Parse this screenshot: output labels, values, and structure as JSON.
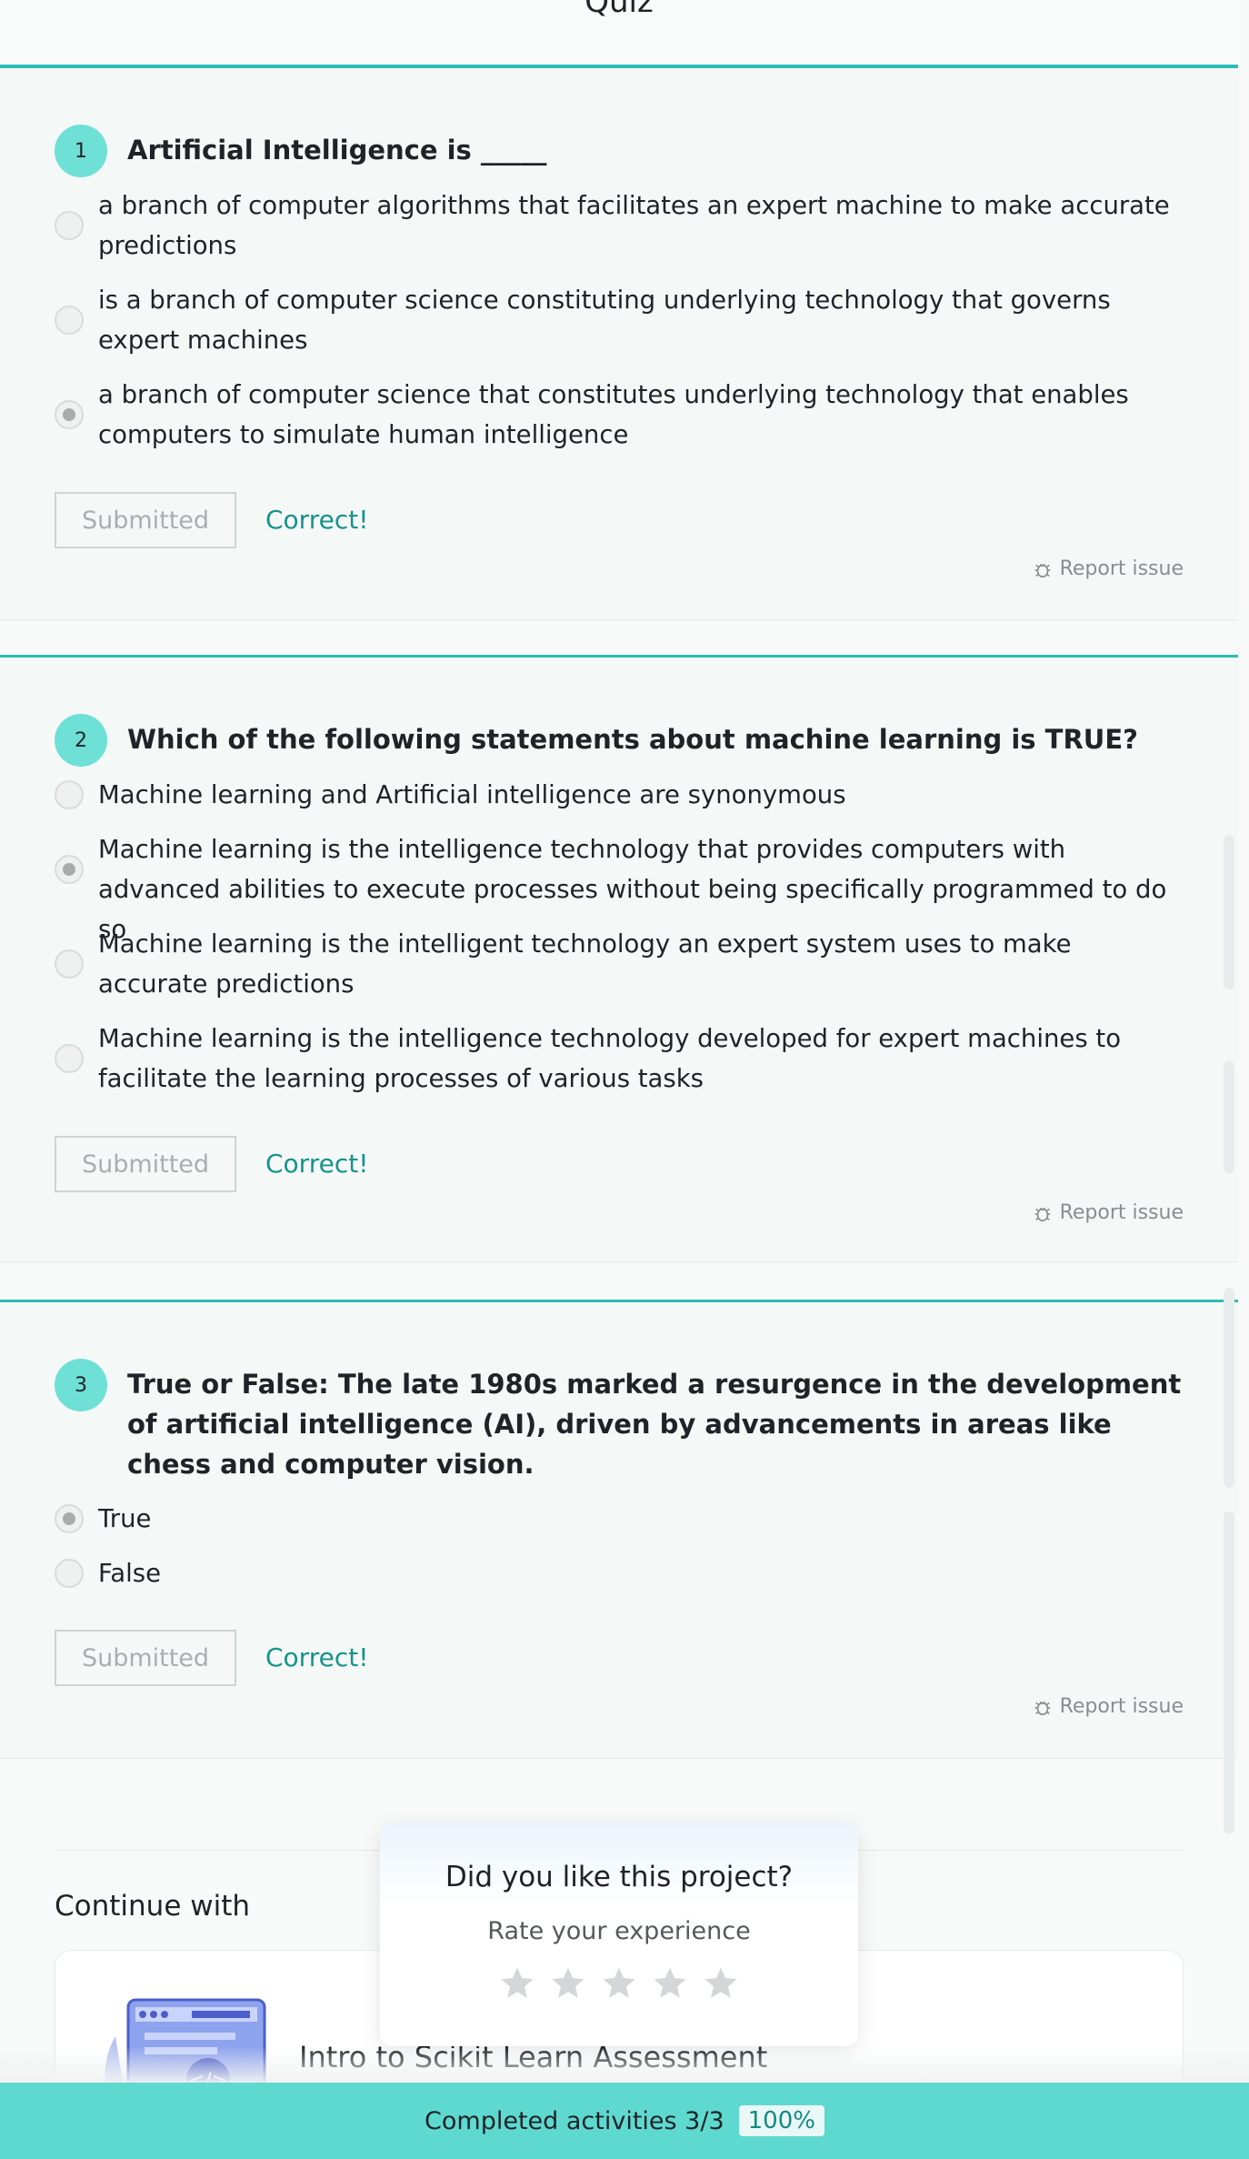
{
  "page": {
    "title": "Quiz"
  },
  "questions": [
    {
      "number": "1",
      "text": "Artificial Intelligence is _____",
      "options": [
        "a branch of computer algorithms that facilitates an expert machine to make accurate predictions",
        "is a branch of computer science constituting underlying technology that governs expert machines",
        "a branch of computer science that constitutes underlying technology that enables computers to simulate human intelligence"
      ],
      "selected_index": 2,
      "submit_label": "Submitted",
      "result": "Correct!",
      "report_label": "Report issue"
    },
    {
      "number": "2",
      "text": "Which of the following statements about machine learning is TRUE?",
      "options": [
        "Machine learning and Artificial intelligence are synonymous",
        "Machine learning is the intelligence technology that provides computers with advanced abilities to execute processes without being specifically programmed to do so",
        "Machine learning is the intelligent technology an expert system uses to make accurate predictions",
        "Machine learning is the intelligence technology developed for expert machines to facilitate the learning processes of various tasks"
      ],
      "selected_index": 1,
      "submit_label": "Submitted",
      "result": "Correct!",
      "report_label": "Report issue"
    },
    {
      "number": "3",
      "text": "True or False: The late 1980s marked a resurgence in the development of artificial intelligence (AI), driven by advancements in areas like chess and computer vision.",
      "options": [
        "True",
        "False"
      ],
      "selected_index": 0,
      "submit_label": "Submitted",
      "result": "Correct!",
      "report_label": "Report issue"
    }
  ],
  "continue": {
    "title": "Continue with",
    "card_title": "Intro to Scikit Learn Assessment"
  },
  "rating": {
    "title": "Did you like this project?",
    "subtitle": "Rate your experience",
    "star_count": 5
  },
  "footer": {
    "text": "Completed activities 3/3",
    "percent": "100%"
  },
  "colors": {
    "accent": "#2bbdb7",
    "number_badge": "#6fe0d6",
    "correct": "#16938c",
    "footer_bg": "#5ed9d0"
  }
}
